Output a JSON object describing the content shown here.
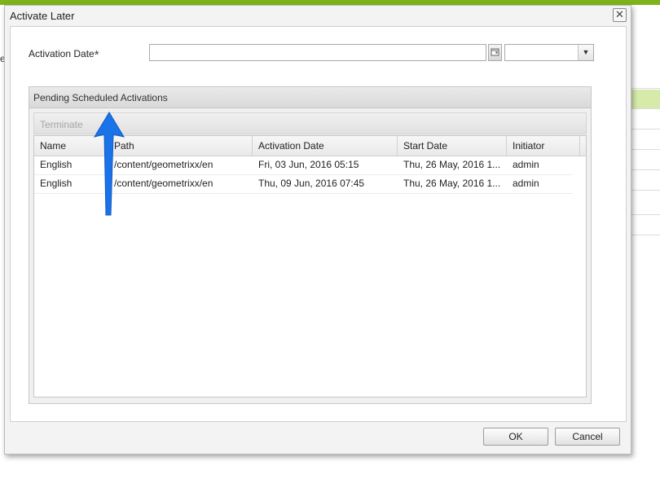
{
  "background": {
    "left_text": "e"
  },
  "dialog": {
    "title": "Activate Later",
    "close_symbol": "✕",
    "form": {
      "activation_date_label": "Activation Date",
      "required_marker": "*",
      "date_value": "",
      "time_value": "",
      "dropdown_arrow": "▼"
    },
    "panel": {
      "title": "Pending Scheduled Activations",
      "toolbar": {
        "terminate_label": "Terminate"
      },
      "grid": {
        "columns": [
          "Name",
          "Path",
          "Activation Date",
          "Start Date",
          "Initiator"
        ],
        "rows": [
          {
            "name": "English",
            "path": "/content/geometrixx/en",
            "activation_date": "Fri, 03 Jun, 2016 05:15",
            "start_date": "Thu, 26 May, 2016 1...",
            "initiator": "admin"
          },
          {
            "name": "English",
            "path": "/content/geometrixx/en",
            "activation_date": "Thu, 09 Jun, 2016 07:45",
            "start_date": "Thu, 26 May, 2016 1...",
            "initiator": "admin"
          }
        ]
      }
    },
    "footer": {
      "ok_label": "OK",
      "cancel_label": "Cancel"
    }
  },
  "colors": {
    "app_accent": "#7fb21c",
    "selected_row": "#d6ebaa",
    "annotation_arrow": "#1a73e8"
  },
  "icons": {
    "date_trigger": "calendar-icon",
    "close": "close-icon",
    "time_dropdown": "chevron-down-icon",
    "annotation": "arrow-up-icon"
  }
}
